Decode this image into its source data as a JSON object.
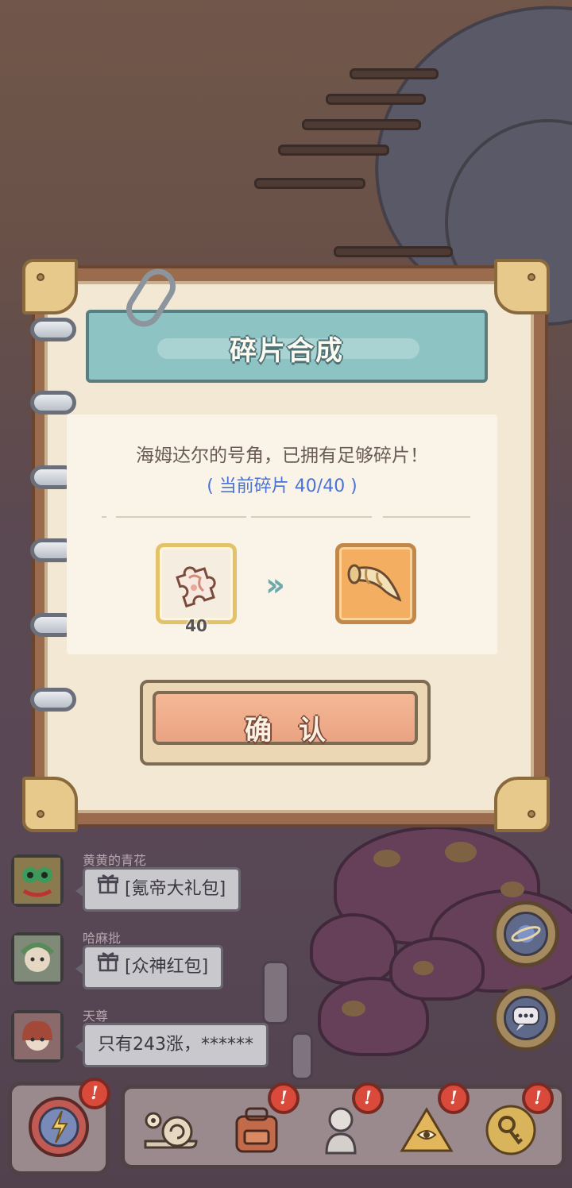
{
  "dialog": {
    "title": "碎片合成",
    "description": "海姆达尔的号角，已拥有足够碎片！",
    "progress_text": "( 当前碎片  40/40 )",
    "fragment_count": "40",
    "arrow_glyph": "››",
    "confirm_label": "确认",
    "fragment_icon": "puzzle-fragment-icon",
    "result_icon": "gjallarhorn-icon"
  },
  "chat": [
    {
      "name": "黄黄的青花",
      "message": "[氪帝大礼包]",
      "has_gift": true
    },
    {
      "name": "哈麻批",
      "message": "[众神红包]",
      "has_gift": true
    },
    {
      "name": "天尊",
      "message": "只有243涨，******",
      "has_gift": false
    }
  ],
  "bottom_bar": {
    "badge_glyph": "!",
    "items": [
      "snail-icon",
      "backpack-icon",
      "statue-icon",
      "pyramid-icon",
      "key-icon"
    ]
  },
  "side_buttons": [
    "planet-icon",
    "chat-icon"
  ],
  "colors": {
    "title_banner": "#8ec3c4",
    "progress_text": "#4a72d6",
    "confirm_button": "#eaa382",
    "badge": "#d94a3a"
  }
}
